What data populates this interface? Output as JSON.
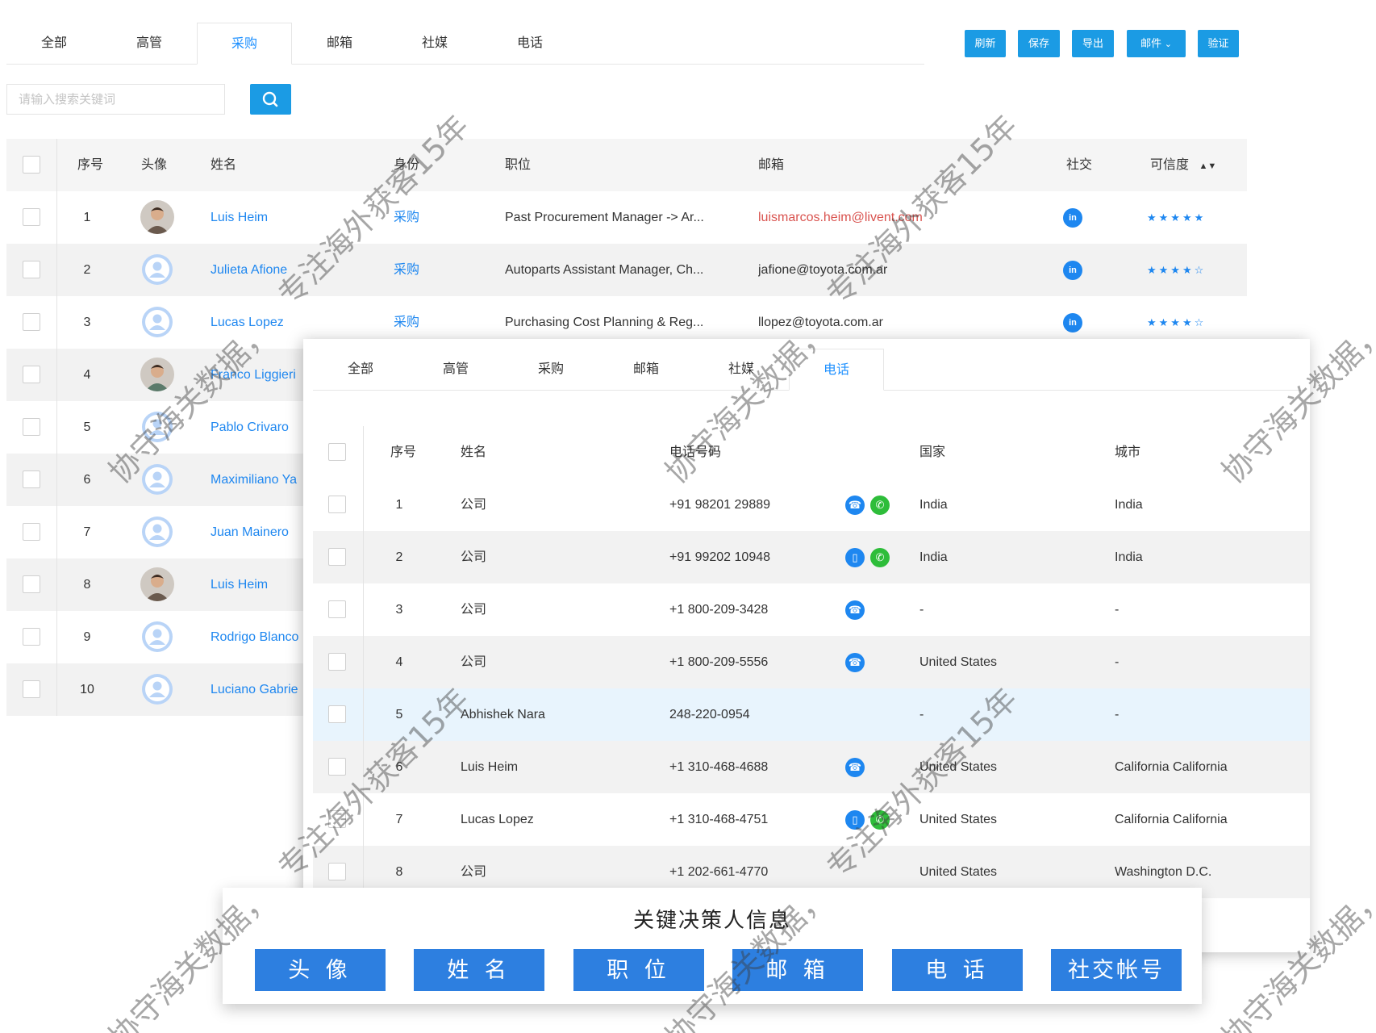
{
  "bg": {
    "tabs": [
      "全部",
      "高管",
      "采购",
      "邮箱",
      "社媒",
      "电话"
    ],
    "active_tab": 2,
    "buttons": [
      "刷新",
      "保存",
      "导出",
      "邮件",
      "验证"
    ],
    "search_placeholder": "请输入搜索关键词",
    "columns": [
      "序号",
      "头像",
      "姓名",
      "身份",
      "职位",
      "邮箱",
      "社交",
      "可信度"
    ],
    "rows": [
      {
        "no": "1",
        "name": "Luis Heim",
        "identity": "采购",
        "title": "Past Procurement Manager -> Ar...",
        "email": "luismarcos.heim@livent.com",
        "email_red": true,
        "avatar": "photo",
        "rating": 5
      },
      {
        "no": "2",
        "name": "Julieta Afione",
        "identity": "采购",
        "title": "Autoparts Assistant Manager, Ch...",
        "email": "jafione@toyota.com.ar",
        "email_red": false,
        "avatar": "default",
        "rating": 4
      },
      {
        "no": "3",
        "name": "Lucas Lopez",
        "identity": "采购",
        "title": "Purchasing Cost Planning & Reg...",
        "email": "llopez@toyota.com.ar",
        "email_red": false,
        "avatar": "default",
        "rating": 4
      },
      {
        "no": "4",
        "name": "Franco Liggieri",
        "avatar": "photo2"
      },
      {
        "no": "5",
        "name": "Pablo Crivaro",
        "avatar": "default"
      },
      {
        "no": "6",
        "name": "Maximiliano Ya",
        "avatar": "default"
      },
      {
        "no": "7",
        "name": "Juan Mainero",
        "avatar": "default"
      },
      {
        "no": "8",
        "name": "Luis Heim",
        "avatar": "photo"
      },
      {
        "no": "9",
        "name": "Rodrigo Blanco",
        "avatar": "default"
      },
      {
        "no": "10",
        "name": "Luciano Gabrie",
        "avatar": "default"
      }
    ]
  },
  "front": {
    "tabs": [
      "全部",
      "高管",
      "采购",
      "邮箱",
      "社媒",
      "电话"
    ],
    "active_tab": 5,
    "columns": [
      "序号",
      "姓名",
      "电话号码",
      "国家",
      "城市"
    ],
    "rows": [
      {
        "no": "1",
        "name": "公司",
        "phone": "+91 98201 29889",
        "icons": [
          "phone-icon",
          "whatsapp-icon"
        ],
        "country": "India",
        "city": "India"
      },
      {
        "no": "2",
        "name": "公司",
        "phone": "+91 99202 10948",
        "icons": [
          "mobile-icon",
          "whatsapp-icon"
        ],
        "country": "India",
        "city": "India"
      },
      {
        "no": "3",
        "name": "公司",
        "phone": "+1 800-209-3428",
        "icons": [
          "phone-icon"
        ],
        "country": "-",
        "city": "-"
      },
      {
        "no": "4",
        "name": "公司",
        "phone": "+1 800-209-5556",
        "icons": [
          "phone-icon"
        ],
        "country": "United States",
        "city": "-"
      },
      {
        "no": "5",
        "name": "Abhishek Nara",
        "phone": "248-220-0954",
        "icons": [],
        "country": "-",
        "city": "-"
      },
      {
        "no": "6",
        "name": "Luis Heim",
        "phone": "+1 310-468-4688",
        "icons": [
          "phone-icon"
        ],
        "country": "United States",
        "city": "California California"
      },
      {
        "no": "7",
        "name": "Lucas Lopez",
        "phone": "+1 310-468-4751",
        "icons": [
          "mobile-icon",
          "whatsapp-icon"
        ],
        "country": "United States",
        "city": "California California"
      },
      {
        "no": "8",
        "name": "公司",
        "phone": "+1 202-661-4770",
        "icons": [],
        "country": "United States",
        "city": "Washington D.C."
      }
    ]
  },
  "info": {
    "title": "关键决策人信息",
    "buttons": [
      "头 像",
      "姓 名",
      "职 位",
      "邮 箱",
      "电 话",
      "社交帐号"
    ]
  },
  "watermark": {
    "line1": "专注海外获客15年",
    "line2": "协守海关数据，"
  },
  "colors": {
    "accent": "#1b9be4",
    "link": "#1e87f0",
    "info_button": "#2d7fe0",
    "email_red": "#d9534f",
    "whatsapp": "#2ebd3a"
  }
}
